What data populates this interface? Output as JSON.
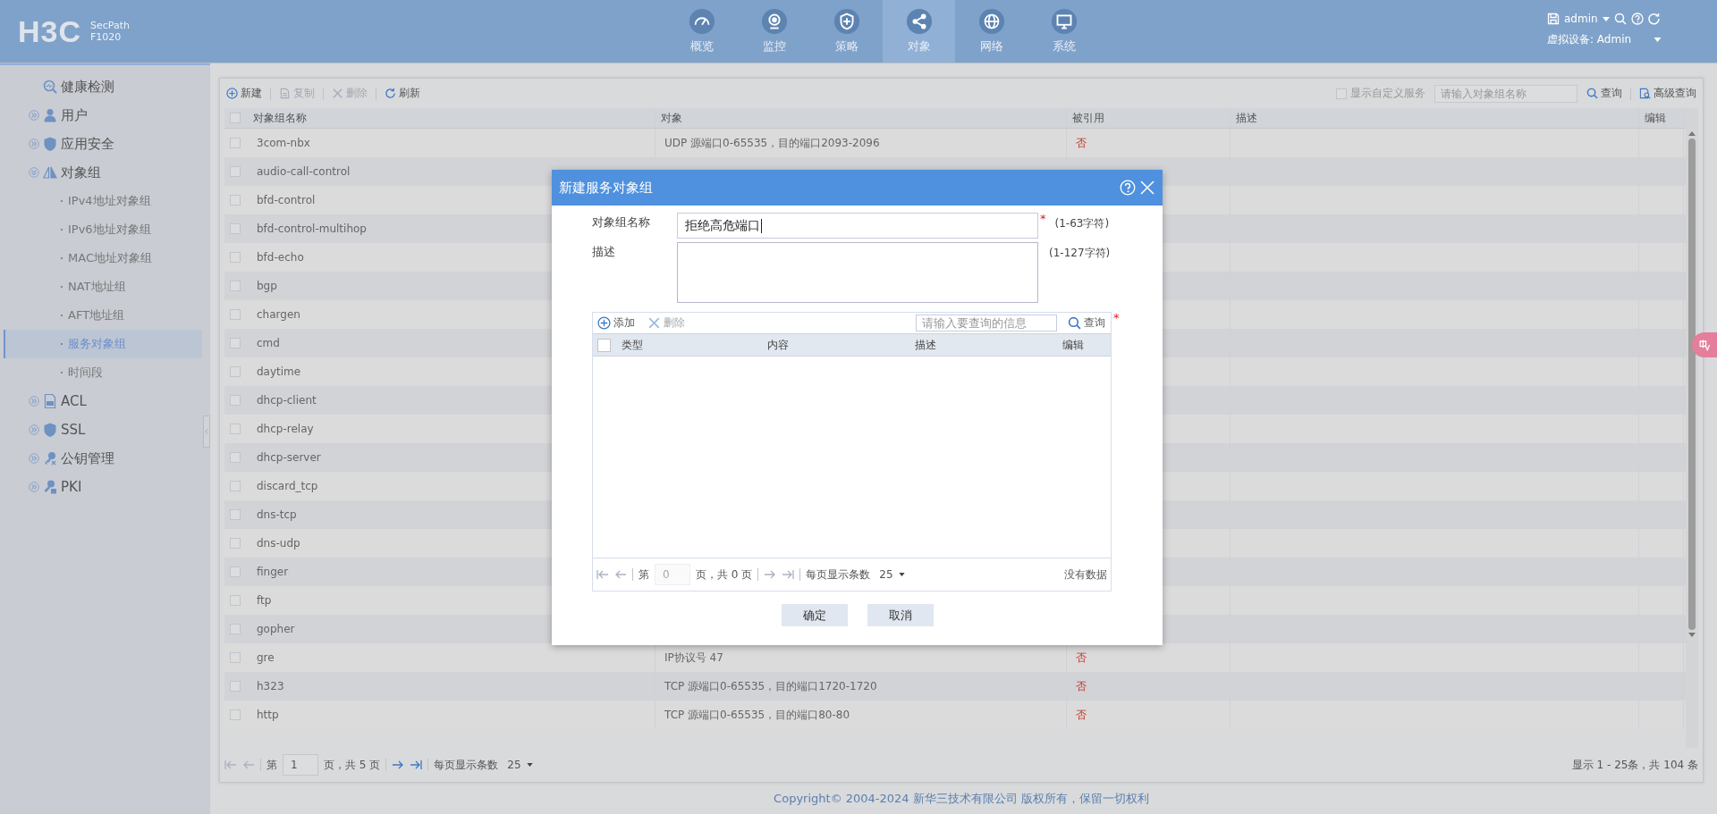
{
  "header": {
    "logo": "H3C",
    "product": "SecPath",
    "model": "F1020",
    "nav": [
      {
        "label": "概览",
        "selected": false
      },
      {
        "label": "监控",
        "selected": false
      },
      {
        "label": "策略",
        "selected": false
      },
      {
        "label": "对象",
        "selected": true
      },
      {
        "label": "网络",
        "selected": false
      },
      {
        "label": "系统",
        "selected": false
      }
    ],
    "user": "admin",
    "device": "虚拟设备: Admin"
  },
  "sidebar": {
    "items": [
      {
        "label": "健康检测"
      },
      {
        "label": "用户",
        "expanded": false
      },
      {
        "label": "应用安全",
        "expanded": false
      },
      {
        "label": "对象组",
        "expanded": true,
        "children": [
          {
            "label": "IPv4地址对象组",
            "selected": false
          },
          {
            "label": "IPv6地址对象组",
            "selected": false
          },
          {
            "label": "MAC地址对象组",
            "selected": false
          },
          {
            "label": "NAT地址组",
            "selected": false
          },
          {
            "label": "AFT地址组",
            "selected": false
          },
          {
            "label": "服务对象组",
            "selected": true
          },
          {
            "label": "时间段",
            "selected": false
          }
        ]
      },
      {
        "label": "ACL",
        "expanded": false
      },
      {
        "label": "SSL",
        "expanded": false
      },
      {
        "label": "公钥管理",
        "expanded": false
      },
      {
        "label": "PKI",
        "expanded": false
      }
    ]
  },
  "toolbar": {
    "actions": [
      {
        "label": "新建",
        "disabled": false
      },
      {
        "label": "复制",
        "disabled": true
      },
      {
        "label": "删除",
        "disabled": true
      },
      {
        "label": "刷新",
        "disabled": false
      }
    ],
    "custom_service": {
      "label": "显示自定义服务",
      "checked": false
    },
    "search": {
      "placeholder": "请输入对象组名称"
    },
    "query": "查询",
    "advanced": "高级查询"
  },
  "table": {
    "columns": [
      "对象组名称",
      "对象",
      "被引用",
      "描述",
      "编辑"
    ],
    "header_checked": false,
    "rows": [
      {
        "name": "3com-nbx",
        "object": "UDP 源端口0-65535，目的端口2093-2096",
        "referenced": "否",
        "checked": false
      },
      {
        "name": "audio-call-control",
        "checked": false
      },
      {
        "name": "bfd-control",
        "checked": false
      },
      {
        "name": "bfd-control-multihop",
        "checked": false
      },
      {
        "name": "bfd-echo",
        "checked": false
      },
      {
        "name": "bgp",
        "checked": false
      },
      {
        "name": "chargen",
        "checked": false
      },
      {
        "name": "cmd",
        "checked": false
      },
      {
        "name": "daytime",
        "checked": false
      },
      {
        "name": "dhcp-client",
        "checked": false
      },
      {
        "name": "dhcp-relay",
        "checked": false
      },
      {
        "name": "dhcp-server",
        "checked": false
      },
      {
        "name": "discard_tcp",
        "checked": false
      },
      {
        "name": "dns-tcp",
        "checked": false
      },
      {
        "name": "dns-udp",
        "checked": false
      },
      {
        "name": "finger",
        "checked": false
      },
      {
        "name": "ftp",
        "checked": false
      },
      {
        "name": "gopher",
        "checked": false
      },
      {
        "name": "gre",
        "object": "IP协议号 47",
        "referenced": "否",
        "checked": false
      },
      {
        "name": "h323",
        "object": "TCP 源端口0-65535，目的端口1720-1720",
        "referenced": "否",
        "checked": false
      },
      {
        "name": "http",
        "object": "TCP 源端口0-65535，目的端口80-80",
        "referenced": "否",
        "checked": false
      }
    ]
  },
  "pager": {
    "page_prefix": "第",
    "page": "1",
    "page_total": "页，共 5 页",
    "per_page_label": "每页显示条数",
    "per_page": "25",
    "summary": "显示 1 - 25条，共 104 条"
  },
  "dialog": {
    "title": "新建服务对象组",
    "name_field": {
      "label": "对象组名称",
      "value": "拒绝高危端口",
      "required_mark": "*",
      "hint": "(1-63字符)"
    },
    "desc_field": {
      "label": "描述",
      "hint": "(1-127字符)"
    },
    "members": {
      "add": "添加",
      "delete": "删除",
      "delete_disabled": true,
      "search_placeholder": "请输入要查询的信息",
      "query": "查询",
      "required_mark": "*",
      "columns": [
        "类型",
        "内容",
        "描述",
        "编辑"
      ],
      "header_checked": false,
      "pager": {
        "page_prefix": "第",
        "page": "0",
        "page_total": "页，共 0 页",
        "per_page_label": "每页显示条数",
        "per_page": "25",
        "summary": "没有数据"
      }
    },
    "buttons": [
      "确定",
      "取消"
    ]
  },
  "footer": "Copyright© 2004-2024 新华三技术有限公司 版权所有，保留一切权利"
}
